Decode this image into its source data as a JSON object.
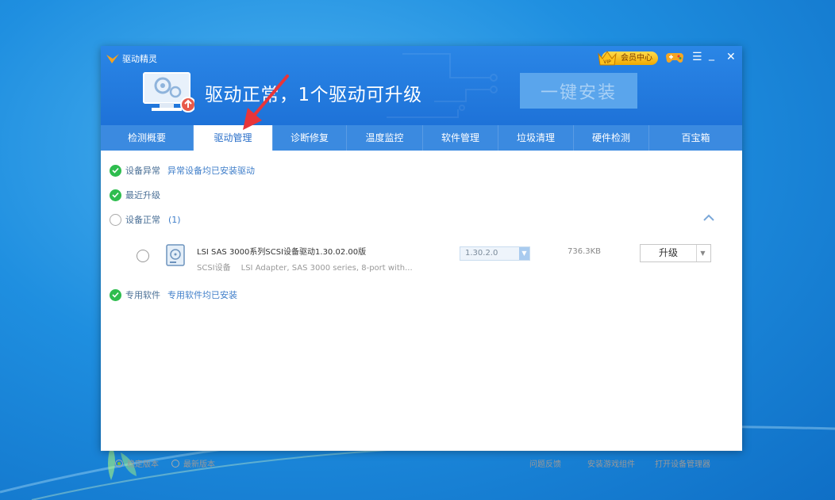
{
  "app": {
    "brand": "驱动精灵",
    "headline": "驱动正常，1个驱动可升级",
    "install_button": "一键安装",
    "vip_label": "会员中心",
    "vip_badge": "VIP"
  },
  "window_controls": {
    "menu": "☰",
    "minimize": "_",
    "close": "✕"
  },
  "tabs": [
    {
      "label": "检测概要",
      "active": false
    },
    {
      "label": "驱动管理",
      "active": true
    },
    {
      "label": "诊断修复",
      "active": false
    },
    {
      "label": "温度监控",
      "active": false
    },
    {
      "label": "软件管理",
      "active": false
    },
    {
      "label": "垃圾清理",
      "active": false
    },
    {
      "label": "硬件检测",
      "active": false
    },
    {
      "label": "百宝箱",
      "active": false
    }
  ],
  "sections": {
    "abnormal": {
      "label": "设备异常",
      "note": "异常设备均已安装驱动"
    },
    "recent": {
      "label": "最近升级"
    },
    "normal": {
      "label": "设备正常",
      "count": "(1)"
    },
    "software": {
      "label": "专用软件",
      "note": "专用软件均已安装"
    }
  },
  "driver": {
    "name": "LSI SAS 3000系列SCSI设备驱动1.30.02.00版",
    "category": "SCSI设备",
    "description": "LSI Adapter, SAS 3000 series, 8-port with...",
    "version": "1.30.2.0",
    "size": "736.3KB",
    "action": "升级"
  },
  "footer": {
    "stable": "稳定版本",
    "latest": "最新版本",
    "links": [
      "问题反馈",
      "安装游戏组件",
      "打开设备管理器"
    ]
  },
  "colors": {
    "header": "#1e72d8",
    "tabbar": "#3b8ae0",
    "check": "#2ebd4e",
    "annotation_arrow": "#e8353a"
  }
}
